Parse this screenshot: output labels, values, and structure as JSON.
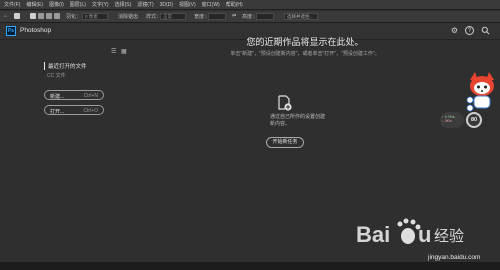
{
  "menubar": {
    "items": [
      "文件(F)",
      "编辑(E)",
      "图像(I)",
      "图层(L)",
      "文字(Y)",
      "选择(S)",
      "滤镜(T)",
      "3D(D)",
      "视图(V)",
      "窗口(W)",
      "帮助(H)"
    ]
  },
  "options": {
    "feather_label": "羽化：",
    "feather_value": "0 像素",
    "antialias_label": "消除锯齿",
    "style_label": "样式：",
    "style_value": "正常",
    "width_label": "宽度：",
    "height_label": "高度：",
    "mask_button": "选择并遮住..."
  },
  "app": {
    "title": "Photoshop",
    "logo_text": "Ps"
  },
  "sidebar": {
    "recent_title": "最近打开的文件",
    "recent_empty": "CC 文件",
    "new_label": "新建...",
    "new_shortcut": "Ctrl+N",
    "open_label": "打开...",
    "open_shortcut": "Ctrl+O"
  },
  "main": {
    "heading": "您的近期作品将显示在此处。",
    "subtext": "单击\"新建\"，\"预设创建新内容\"，或者单击\"打开\"，\"预设创建工作\"。",
    "newdoc_text_1": "通过自己所作的设置创建",
    "newdoc_text_2": "新内容。",
    "start_button": "开始新任务"
  },
  "overlays": {
    "net_up": "↑ 0.7K/s",
    "net_down": "↓ 3K/s",
    "percent": "80",
    "watermark_brand": "Bai du 经验",
    "watermark_url": "jingyan.baidu.com"
  },
  "colors": {
    "accent": "#31a8ff",
    "background": "#2f2f2f",
    "menubar": "#3a3a3a"
  },
  "icons": {
    "settings": "gear-icon",
    "help": "help-icon",
    "search": "search-icon",
    "list_view": "list-view-icon",
    "grid_view": "grid-view-icon",
    "new_document": "new-document-icon"
  }
}
